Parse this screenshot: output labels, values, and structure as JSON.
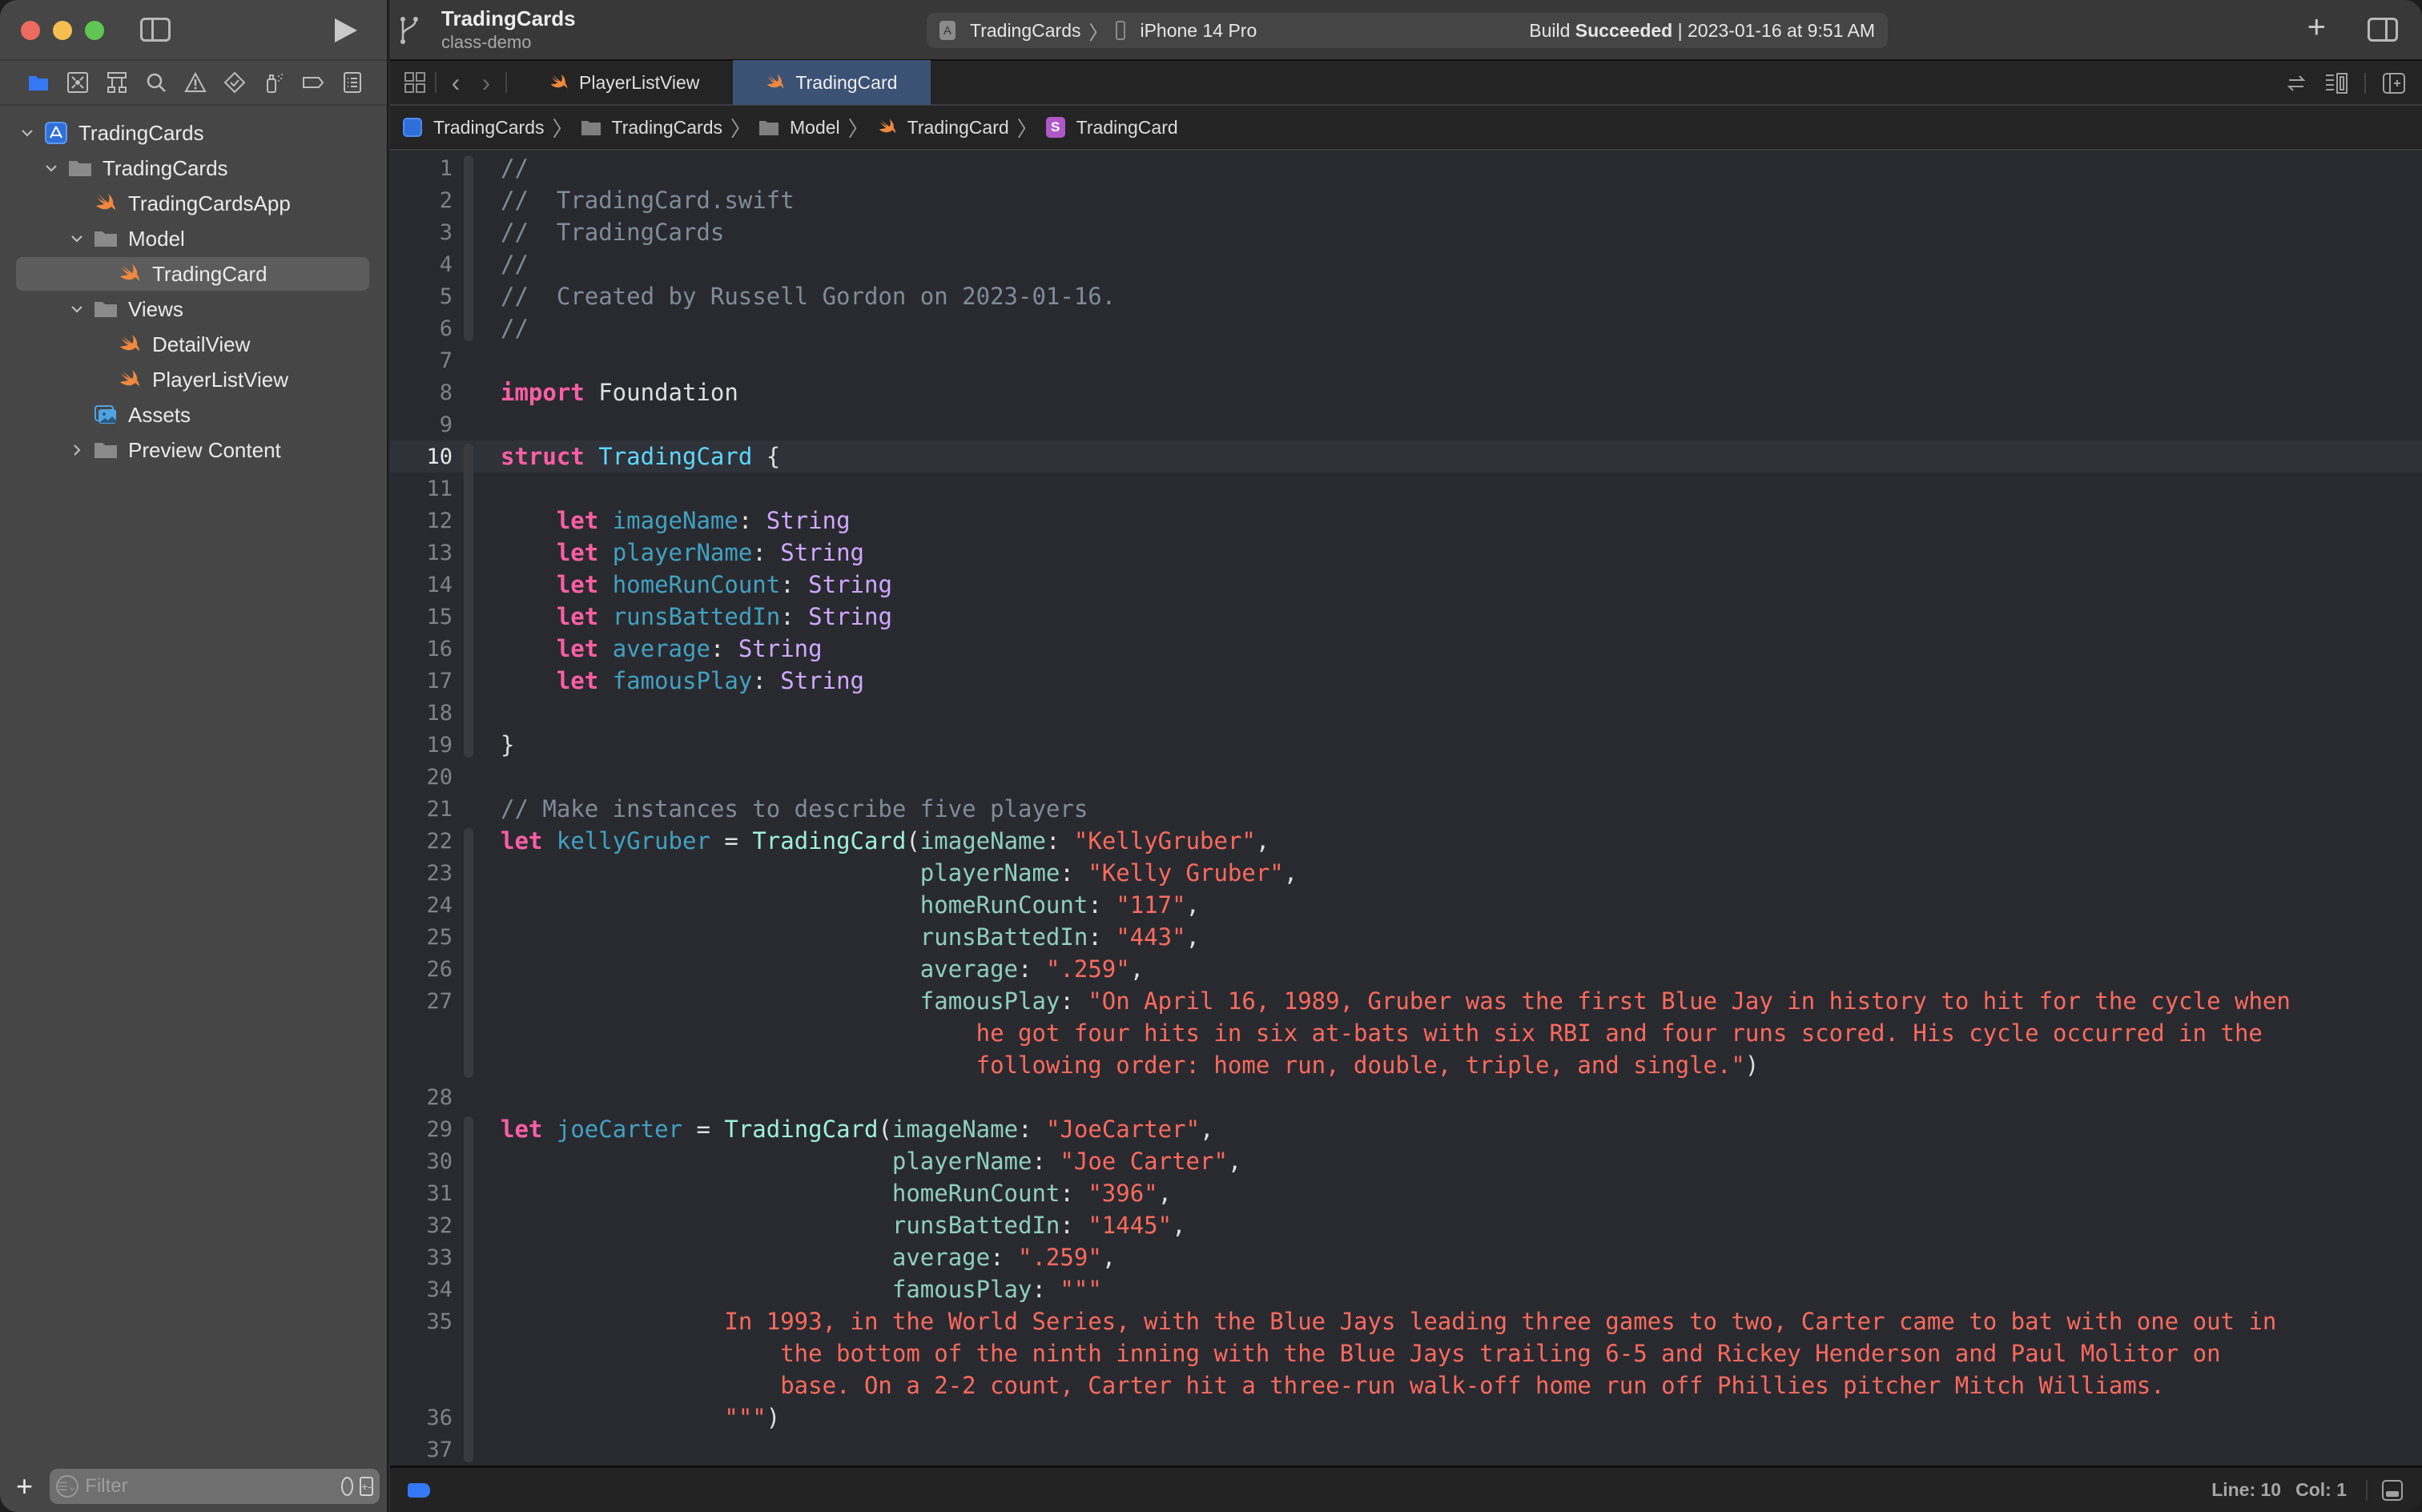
{
  "window": {
    "project_title": "TradingCards",
    "branch": "class-demo",
    "activity": {
      "scheme": "TradingCards",
      "device": "iPhone 14 Pro",
      "build_prefix": "Build",
      "build_result": "Succeeded",
      "build_time": "| 2023-01-16 at 9:51 AM"
    }
  },
  "navigator": {
    "tree": [
      {
        "label": "TradingCards",
        "icon": "app-project-icon",
        "level": 0,
        "expanded": true
      },
      {
        "label": "TradingCards",
        "icon": "folder-icon",
        "level": 1,
        "expanded": true
      },
      {
        "label": "TradingCardsApp",
        "icon": "swift-file-icon",
        "level": 2
      },
      {
        "label": "Model",
        "icon": "folder-icon",
        "level": 2,
        "expanded": true
      },
      {
        "label": "TradingCard",
        "icon": "swift-file-icon",
        "level": 3,
        "selected": true
      },
      {
        "label": "Views",
        "icon": "folder-icon",
        "level": 2,
        "expanded": true
      },
      {
        "label": "DetailView",
        "icon": "swift-file-icon",
        "level": 3
      },
      {
        "label": "PlayerListView",
        "icon": "swift-file-icon",
        "level": 3
      },
      {
        "label": "Assets",
        "icon": "asset-catalog-icon",
        "level": 2
      },
      {
        "label": "Preview Content",
        "icon": "folder-icon",
        "level": 2,
        "expanded": false
      }
    ],
    "filter_placeholder": "Filter"
  },
  "tabs": [
    {
      "label": "PlayerListView",
      "active": false
    },
    {
      "label": "TradingCard",
      "active": true
    }
  ],
  "breadcrumb": [
    {
      "label": "TradingCards",
      "icon": "app-project-icon"
    },
    {
      "label": "TradingCards",
      "icon": "folder-icon"
    },
    {
      "label": "Model",
      "icon": "folder-icon"
    },
    {
      "label": "TradingCard",
      "icon": "swift-file-icon"
    },
    {
      "label": "TradingCard",
      "icon": "struct-symbol-icon"
    }
  ],
  "editor": {
    "current_line": 10,
    "lines": [
      {
        "n": "1",
        "tokens": [
          [
            "c-com",
            "//"
          ]
        ]
      },
      {
        "n": "2",
        "tokens": [
          [
            "c-com",
            "//  TradingCard.swift"
          ]
        ]
      },
      {
        "n": "3",
        "tokens": [
          [
            "c-com",
            "//  TradingCards"
          ]
        ]
      },
      {
        "n": "4",
        "tokens": [
          [
            "c-com",
            "//"
          ]
        ]
      },
      {
        "n": "5",
        "tokens": [
          [
            "c-com",
            "//  Created by Russell Gordon on 2023-01-16."
          ]
        ]
      },
      {
        "n": "6",
        "tokens": [
          [
            "c-com",
            "//"
          ]
        ]
      },
      {
        "n": "7",
        "tokens": []
      },
      {
        "n": "8",
        "tokens": [
          [
            "c-kw",
            "import"
          ],
          [
            "c-plain",
            " Foundation"
          ]
        ]
      },
      {
        "n": "9",
        "tokens": []
      },
      {
        "n": "10",
        "tokens": [
          [
            "c-kw",
            "struct"
          ],
          [
            "c-plain",
            " "
          ],
          [
            "c-type",
            "TradingCard"
          ],
          [
            "c-plain",
            " {"
          ]
        ]
      },
      {
        "n": "11",
        "tokens": []
      },
      {
        "n": "12",
        "tokens": [
          [
            "c-plain",
            "    "
          ],
          [
            "c-kw",
            "let"
          ],
          [
            "c-plain",
            " "
          ],
          [
            "c-decl",
            "imageName"
          ],
          [
            "c-plain",
            ": "
          ],
          [
            "c-lib",
            "String"
          ]
        ]
      },
      {
        "n": "13",
        "tokens": [
          [
            "c-plain",
            "    "
          ],
          [
            "c-kw",
            "let"
          ],
          [
            "c-plain",
            " "
          ],
          [
            "c-decl",
            "playerName"
          ],
          [
            "c-plain",
            ": "
          ],
          [
            "c-lib",
            "String"
          ]
        ]
      },
      {
        "n": "14",
        "tokens": [
          [
            "c-plain",
            "    "
          ],
          [
            "c-kw",
            "let"
          ],
          [
            "c-plain",
            " "
          ],
          [
            "c-decl",
            "homeRunCount"
          ],
          [
            "c-plain",
            ": "
          ],
          [
            "c-lib",
            "String"
          ]
        ]
      },
      {
        "n": "15",
        "tokens": [
          [
            "c-plain",
            "    "
          ],
          [
            "c-kw",
            "let"
          ],
          [
            "c-plain",
            " "
          ],
          [
            "c-decl",
            "runsBattedIn"
          ],
          [
            "c-plain",
            ": "
          ],
          [
            "c-lib",
            "String"
          ]
        ]
      },
      {
        "n": "16",
        "tokens": [
          [
            "c-plain",
            "    "
          ],
          [
            "c-kw",
            "let"
          ],
          [
            "c-plain",
            " "
          ],
          [
            "c-decl",
            "average"
          ],
          [
            "c-plain",
            ": "
          ],
          [
            "c-lib",
            "String"
          ]
        ]
      },
      {
        "n": "17",
        "tokens": [
          [
            "c-plain",
            "    "
          ],
          [
            "c-kw",
            "let"
          ],
          [
            "c-plain",
            " "
          ],
          [
            "c-decl",
            "famousPlay"
          ],
          [
            "c-plain",
            ": "
          ],
          [
            "c-lib",
            "String"
          ]
        ]
      },
      {
        "n": "18",
        "tokens": []
      },
      {
        "n": "19",
        "tokens": [
          [
            "c-plain",
            "}"
          ]
        ]
      },
      {
        "n": "20",
        "tokens": []
      },
      {
        "n": "21",
        "tokens": [
          [
            "c-com",
            "// Make instances to describe five players"
          ]
        ]
      },
      {
        "n": "22",
        "tokens": [
          [
            "c-kw",
            "let"
          ],
          [
            "c-plain",
            " "
          ],
          [
            "c-decl",
            "kellyGruber"
          ],
          [
            "c-plain",
            " = "
          ],
          [
            "c-call",
            "TradingCard"
          ],
          [
            "c-plain",
            "("
          ],
          [
            "c-label",
            "imageName"
          ],
          [
            "c-plain",
            ": "
          ],
          [
            "c-str",
            "\"KellyGruber\""
          ],
          [
            "c-plain",
            ","
          ]
        ]
      },
      {
        "n": "23",
        "tokens": [
          [
            "c-plain",
            "                              "
          ],
          [
            "c-label",
            "playerName"
          ],
          [
            "c-plain",
            ": "
          ],
          [
            "c-str",
            "\"Kelly Gruber\""
          ],
          [
            "c-plain",
            ","
          ]
        ]
      },
      {
        "n": "24",
        "tokens": [
          [
            "c-plain",
            "                              "
          ],
          [
            "c-label",
            "homeRunCount"
          ],
          [
            "c-plain",
            ": "
          ],
          [
            "c-str",
            "\"117\""
          ],
          [
            "c-plain",
            ","
          ]
        ]
      },
      {
        "n": "25",
        "tokens": [
          [
            "c-plain",
            "                              "
          ],
          [
            "c-label",
            "runsBattedIn"
          ],
          [
            "c-plain",
            ": "
          ],
          [
            "c-str",
            "\"443\""
          ],
          [
            "c-plain",
            ","
          ]
        ]
      },
      {
        "n": "26",
        "tokens": [
          [
            "c-plain",
            "                              "
          ],
          [
            "c-label",
            "average"
          ],
          [
            "c-plain",
            ": "
          ],
          [
            "c-str",
            "\".259\""
          ],
          [
            "c-plain",
            ","
          ]
        ]
      },
      {
        "n": "27",
        "tokens": [
          [
            "c-plain",
            "                              "
          ],
          [
            "c-label",
            "famousPlay"
          ],
          [
            "c-plain",
            ": "
          ],
          [
            "c-str",
            "\"On April 16, 1989, Gruber was the first Blue Jay in history to hit for the cycle when"
          ]
        ]
      },
      {
        "n": "",
        "tokens": [
          [
            "c-plain",
            "                                  "
          ],
          [
            "c-str",
            "he got four hits in six at-bats with six RBI and four runs scored. His cycle occurred in the"
          ]
        ]
      },
      {
        "n": "",
        "tokens": [
          [
            "c-plain",
            "                                  "
          ],
          [
            "c-str",
            "following order: home run, double, triple, and single.\""
          ],
          [
            "c-plain",
            ")"
          ]
        ]
      },
      {
        "n": "28",
        "tokens": []
      },
      {
        "n": "29",
        "tokens": [
          [
            "c-kw",
            "let"
          ],
          [
            "c-plain",
            " "
          ],
          [
            "c-decl",
            "joeCarter"
          ],
          [
            "c-plain",
            " = "
          ],
          [
            "c-call",
            "TradingCard"
          ],
          [
            "c-plain",
            "("
          ],
          [
            "c-label",
            "imageName"
          ],
          [
            "c-plain",
            ": "
          ],
          [
            "c-str",
            "\"JoeCarter\""
          ],
          [
            "c-plain",
            ","
          ]
        ]
      },
      {
        "n": "30",
        "tokens": [
          [
            "c-plain",
            "                            "
          ],
          [
            "c-label",
            "playerName"
          ],
          [
            "c-plain",
            ": "
          ],
          [
            "c-str",
            "\"Joe Carter\""
          ],
          [
            "c-plain",
            ","
          ]
        ]
      },
      {
        "n": "31",
        "tokens": [
          [
            "c-plain",
            "                            "
          ],
          [
            "c-label",
            "homeRunCount"
          ],
          [
            "c-plain",
            ": "
          ],
          [
            "c-str",
            "\"396\""
          ],
          [
            "c-plain",
            ","
          ]
        ]
      },
      {
        "n": "32",
        "tokens": [
          [
            "c-plain",
            "                            "
          ],
          [
            "c-label",
            "runsBattedIn"
          ],
          [
            "c-plain",
            ": "
          ],
          [
            "c-str",
            "\"1445\""
          ],
          [
            "c-plain",
            ","
          ]
        ]
      },
      {
        "n": "33",
        "tokens": [
          [
            "c-plain",
            "                            "
          ],
          [
            "c-label",
            "average"
          ],
          [
            "c-plain",
            ": "
          ],
          [
            "c-str",
            "\".259\""
          ],
          [
            "c-plain",
            ","
          ]
        ]
      },
      {
        "n": "34",
        "tokens": [
          [
            "c-plain",
            "                            "
          ],
          [
            "c-label",
            "famousPlay"
          ],
          [
            "c-plain",
            ": "
          ],
          [
            "c-str",
            "\"\"\""
          ]
        ]
      },
      {
        "n": "35",
        "tokens": [
          [
            "c-plain",
            "                "
          ],
          [
            "c-str",
            "In 1993, in the World Series, with the Blue Jays leading three games to two, Carter came to bat with one out in"
          ]
        ]
      },
      {
        "n": "",
        "tokens": [
          [
            "c-plain",
            "                    "
          ],
          [
            "c-str",
            "the bottom of the ninth inning with the Blue Jays trailing 6-5 and Rickey Henderson and Paul Molitor on"
          ]
        ]
      },
      {
        "n": "",
        "tokens": [
          [
            "c-plain",
            "                    "
          ],
          [
            "c-str",
            "base. On a 2-2 count, Carter hit a three-run walk-off home run off Phillies pitcher Mitch Williams."
          ]
        ]
      },
      {
        "n": "36",
        "tokens": [
          [
            "c-plain",
            "                "
          ],
          [
            "c-str",
            "\"\"\""
          ],
          [
            "c-plain",
            ")"
          ]
        ]
      },
      {
        "n": "37",
        "tokens": []
      }
    ]
  },
  "status": {
    "line_label": "Line: 10",
    "col_label": "Col: 1"
  },
  "colors": {
    "accent": "#3478f6",
    "active_tab": "#3b5275",
    "swift_orange": "#f0883e",
    "keyword": "#fc5fa3",
    "string": "#fc6a5d",
    "comment": "#7f8c98",
    "type": "#5dd8ff"
  }
}
